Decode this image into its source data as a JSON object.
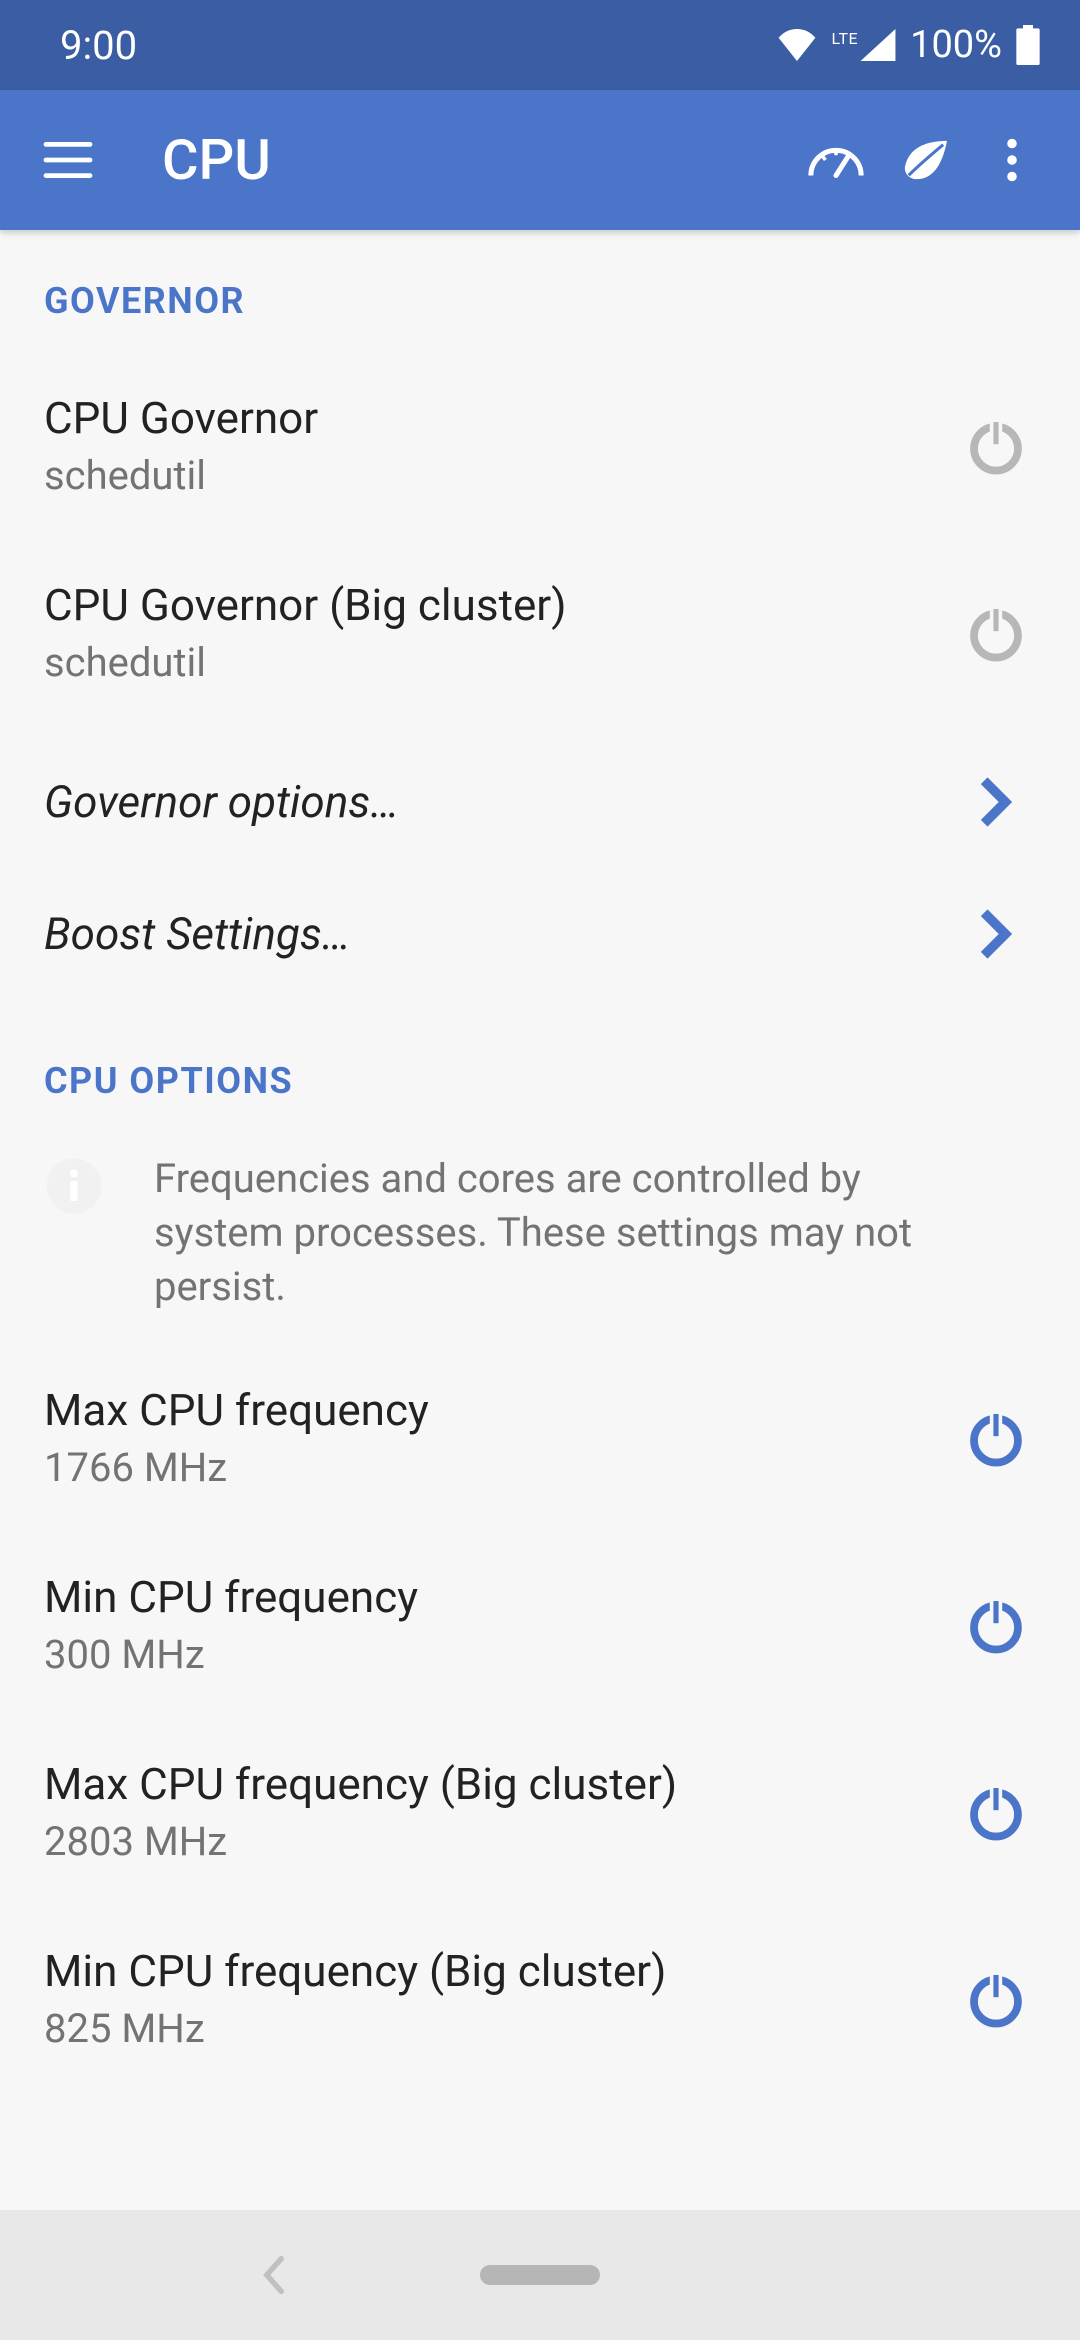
{
  "status": {
    "time": "9:00",
    "battery": "100%"
  },
  "appbar": {
    "title": "CPU"
  },
  "sections": {
    "governor": {
      "header": "GOVERNOR",
      "cpu_gov_title": "CPU Governor",
      "cpu_gov_value": "schedutil",
      "cpu_gov_big_title": "CPU Governor (Big cluster)",
      "cpu_gov_big_value": "schedutil",
      "gov_options": "Governor options…",
      "boost_settings": "Boost Settings…"
    },
    "cpu_options": {
      "header": "CPU OPTIONS",
      "info": "Frequencies and cores are controlled by system processes. These settings may not persist.",
      "max_freq_title": "Max CPU frequency",
      "max_freq_value": "1766 MHz",
      "min_freq_title": "Min CPU frequency",
      "min_freq_value": "300 MHz",
      "max_freq_big_title": "Max CPU frequency (Big cluster)",
      "max_freq_big_value": "2803 MHz",
      "min_freq_big_title": "Min CPU frequency (Big cluster)",
      "min_freq_big_value": "825 MHz"
    }
  }
}
